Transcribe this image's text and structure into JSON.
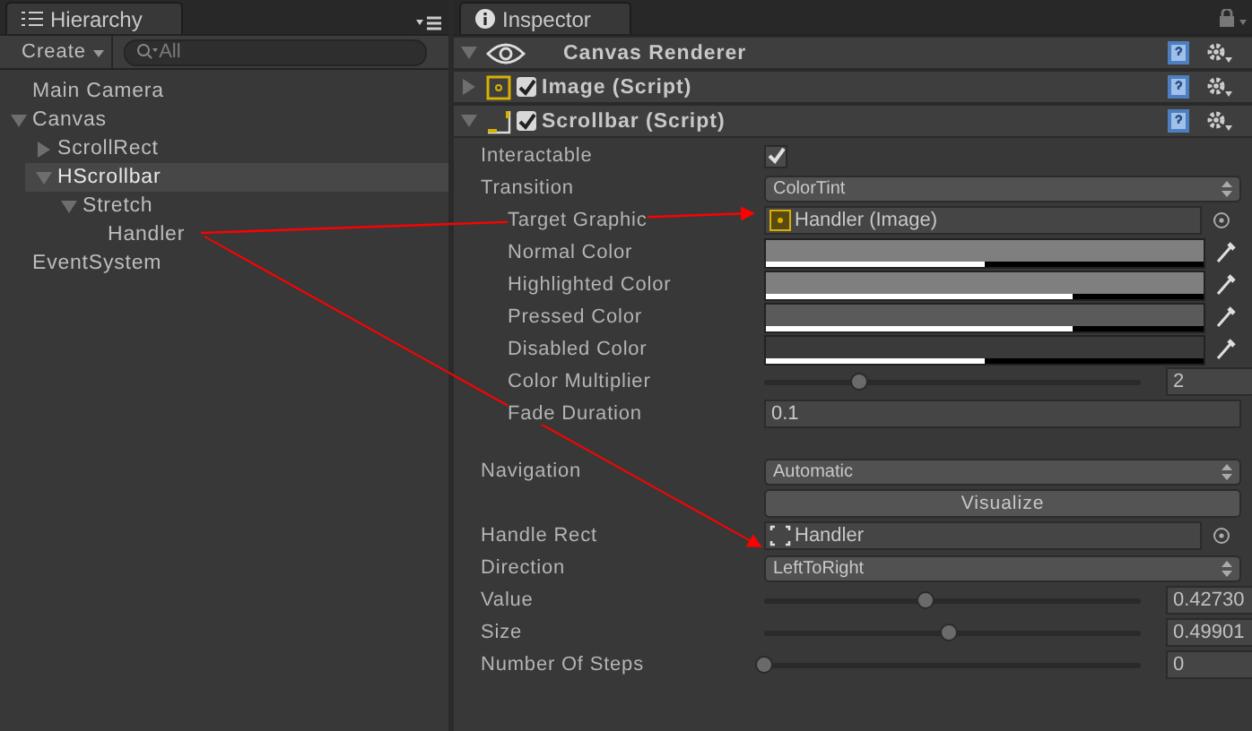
{
  "hierarchy": {
    "title": "Hierarchy",
    "create": "Create",
    "search": {
      "placeholder": "All"
    },
    "tree": [
      {
        "label": "Main Camera",
        "selected": false
      },
      {
        "label": "Canvas",
        "selected": false,
        "expanded": true,
        "children": [
          {
            "label": "ScrollRect",
            "selected": false,
            "expanded": false
          },
          {
            "label": "HScrollbar",
            "selected": true,
            "expanded": true,
            "children": [
              {
                "label": "Stretch",
                "selected": false,
                "expanded": true,
                "children": [
                  {
                    "label": "Handler",
                    "selected": false
                  }
                ]
              }
            ]
          }
        ]
      },
      {
        "label": "EventSystem",
        "selected": false
      }
    ]
  },
  "inspector": {
    "title": "Inspector",
    "components": [
      {
        "name": "Canvas Renderer",
        "kind": "renderer",
        "expanded": true
      },
      {
        "name": "Image (Script)",
        "kind": "image",
        "expanded": false,
        "enabled": true
      },
      {
        "name": "Scrollbar (Script)",
        "kind": "scrollbar",
        "expanded": true,
        "enabled": true
      }
    ],
    "properties": [
      {
        "kind": "checkbox",
        "label": "Interactable",
        "checked": true
      },
      {
        "kind": "dropdown",
        "label": "Transition",
        "value": "ColorTint",
        "children": [
          {
            "kind": "graphic",
            "label": "Target Graphic",
            "value": "Handler (Image)"
          },
          {
            "kind": "color",
            "label": "Normal Color",
            "color": "#7f7f7f",
            "level": 0.5
          },
          {
            "kind": "color",
            "label": "Highlighted Color",
            "color": "#7f7f7f",
            "level": 0.7
          },
          {
            "kind": "color",
            "label": "Pressed Color",
            "color": "#5a5a5a",
            "level": 0.7
          },
          {
            "kind": "color",
            "label": "Disabled Color",
            "color": "#3a3a3a",
            "level": 0.5
          },
          {
            "kind": "slider",
            "label": "Color Multiplier",
            "level": 0.25,
            "reading": "2"
          },
          {
            "kind": "text",
            "label": "Fade Duration",
            "value": "0.1"
          }
        ]
      },
      {
        "kind": "dropdown",
        "label": "Navigation",
        "value": "Automatic"
      },
      {
        "kind": "button",
        "label": "Visualize"
      },
      {
        "kind": "handle",
        "label": "Handle Rect",
        "value": "Handler"
      },
      {
        "kind": "dropdown",
        "label": "Direction",
        "value": "LeftToRight"
      },
      {
        "kind": "slider",
        "label": "Value",
        "level": 0.43,
        "reading": "0.42730"
      },
      {
        "kind": "slider",
        "label": "Size",
        "level": 0.49,
        "reading": "0.49901"
      },
      {
        "kind": "slider",
        "label": "Number Of Steps",
        "level": 0,
        "reading": "0"
      }
    ]
  }
}
